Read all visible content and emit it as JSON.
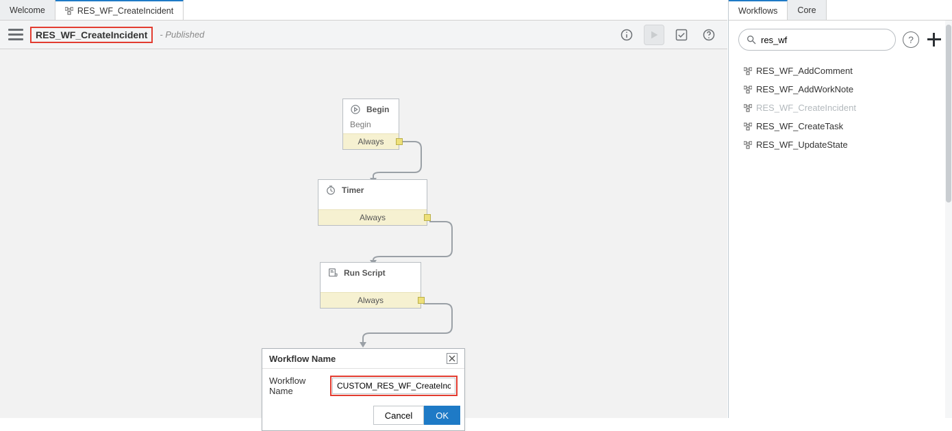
{
  "tabs": {
    "welcome": "Welcome",
    "workflow": "RES_WF_CreateIncident"
  },
  "header": {
    "title": "RES_WF_CreateIncident",
    "status": "- Published"
  },
  "nodes": {
    "begin": {
      "title": "Begin",
      "subtitle": "Begin",
      "exit": "Always"
    },
    "timer": {
      "title": "Timer",
      "exit": "Always"
    },
    "script": {
      "title": "Run Script",
      "exit": "Always"
    }
  },
  "dialog": {
    "title": "Workflow Name",
    "field_label": "Workflow Name",
    "field_value": "CUSTOM_RES_WF_CreateIncident",
    "cancel": "Cancel",
    "ok": "OK"
  },
  "side": {
    "tab_workflows": "Workflows",
    "tab_core": "Core",
    "search_value": "res_wf",
    "items": [
      {
        "label": "RES_WF_AddComment",
        "disabled": false
      },
      {
        "label": "RES_WF_AddWorkNote",
        "disabled": false
      },
      {
        "label": "RES_WF_CreateIncident",
        "disabled": true
      },
      {
        "label": "RES_WF_CreateTask",
        "disabled": false
      },
      {
        "label": "RES_WF_UpdateState",
        "disabled": false
      }
    ]
  }
}
